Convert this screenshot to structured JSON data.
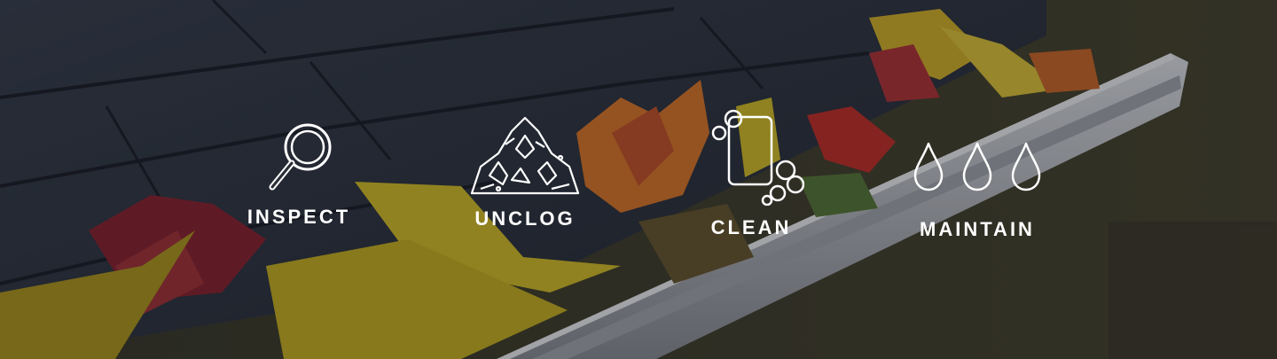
{
  "steps": [
    {
      "label": "INSPECT",
      "icon": "magnifying-glass-icon"
    },
    {
      "label": "UNCLOG",
      "icon": "leaf-pile-icon"
    },
    {
      "label": "CLEAN",
      "icon": "sponge-bubbles-icon"
    },
    {
      "label": "MAINTAIN",
      "icon": "water-drops-icon"
    }
  ],
  "colors": {
    "text": "#ffffff",
    "roof": "#2c3240",
    "gutter": "#c9ccd1",
    "leaf_red": "#c8302a",
    "leaf_orange": "#e07a2a",
    "leaf_yellow": "#d9c228"
  }
}
